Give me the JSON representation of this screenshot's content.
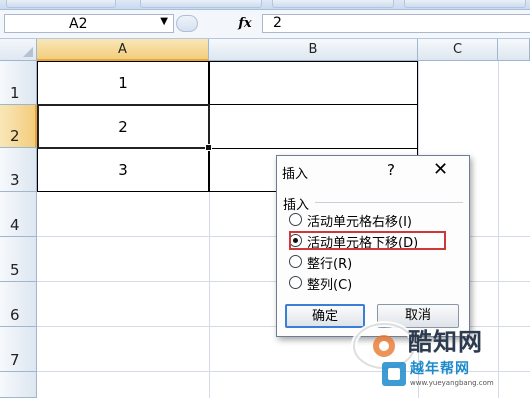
{
  "formula_bar": {
    "name_box": "A2",
    "fx": "fx",
    "formula": "2"
  },
  "columns": [
    {
      "label": "A",
      "selected": true
    },
    {
      "label": "B",
      "selected": false
    },
    {
      "label": "C",
      "selected": false
    }
  ],
  "rows": [
    {
      "label": "1",
      "selected": false
    },
    {
      "label": "2",
      "selected": true
    },
    {
      "label": "3",
      "selected": false
    },
    {
      "label": "4",
      "selected": false
    },
    {
      "label": "5",
      "selected": false
    },
    {
      "label": "6",
      "selected": false
    },
    {
      "label": "7",
      "selected": false
    }
  ],
  "cells": {
    "A1": "1",
    "A2": "2",
    "A3": "3"
  },
  "active_cell": "A2",
  "dialog": {
    "title": "插入",
    "help": "?",
    "close": "✕",
    "group_label": "插入",
    "options": [
      {
        "label": "活动单元格右移(I)",
        "selected": false
      },
      {
        "label": "活动单元格下移(D)",
        "selected": true
      },
      {
        "label": "整行(R)",
        "selected": false
      },
      {
        "label": "整列(C)",
        "selected": false
      }
    ],
    "ok": "确定",
    "cancel": "取消"
  },
  "watermark": {
    "brand": "酷知网",
    "brand2": "越年帮网",
    "url": "www.yueyangbang.com"
  },
  "colors": {
    "selected_header": "#f2cd7d",
    "highlight": "#cf3838",
    "watermark_blue": "#1d8acb"
  }
}
